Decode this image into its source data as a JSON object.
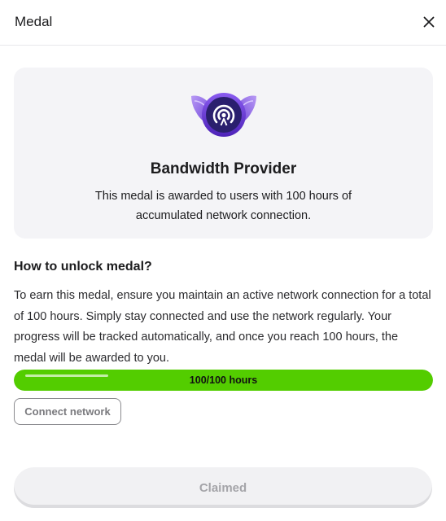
{
  "header": {
    "title": "Medal",
    "close_icon": "close-icon"
  },
  "medal": {
    "icon": "winged-signal-medal-icon",
    "name": "Bandwidth Provider",
    "description": "This medal is awarded to users with 100 hours of accumulated network connection."
  },
  "unlock": {
    "title": "How to unlock medal?",
    "body": "To earn this medal, ensure you maintain an active network connection for a total of 100 hours. Simply stay connected and use the network regularly. Your progress will be tracked automatically, and once you reach 100 hours, the medal will be awarded to you."
  },
  "progress": {
    "label": "100/100 hours",
    "fraction": 1.0,
    "color": "#53cd00"
  },
  "buttons": {
    "connect_label": "Connect network",
    "claim_label": "Claimed"
  }
}
